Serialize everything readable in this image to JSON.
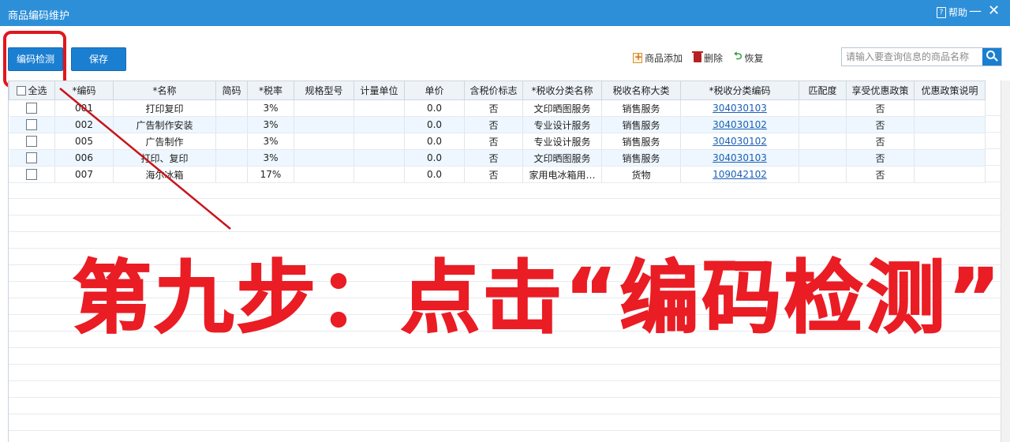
{
  "window": {
    "title": "商品编码维护",
    "help_label": "帮助",
    "minimize": "—",
    "close": "✕"
  },
  "toolbar": {
    "check_label": "编码检测",
    "save_label": "保存",
    "add_label": "商品添加",
    "delete_label": "删除",
    "restore_label": "恢复",
    "restore_icon": "⮌",
    "search_placeholder": "请输入要查询信息的商品名称"
  },
  "table": {
    "select_all": "全选",
    "columns": [
      "*编码",
      "*名称",
      "简码",
      "*税率",
      "规格型号",
      "计量单位",
      "单价",
      "含税价标志",
      "*税收分类名称",
      "税收名称大类",
      "*税收分类编码",
      "匹配度",
      "享受优惠政策",
      "优惠政策说明"
    ],
    "rows": [
      [
        "001",
        "打印复印",
        "",
        "3%",
        "",
        "",
        "0.0",
        "否",
        "文印晒图服务",
        "销售服务",
        "304030103",
        "",
        "否",
        ""
      ],
      [
        "002",
        "广告制作安装",
        "",
        "3%",
        "",
        "",
        "0.0",
        "否",
        "专业设计服务",
        "销售服务",
        "304030102",
        "",
        "否",
        ""
      ],
      [
        "005",
        "广告制作",
        "",
        "3%",
        "",
        "",
        "0.0",
        "否",
        "专业设计服务",
        "销售服务",
        "304030102",
        "",
        "否",
        ""
      ],
      [
        "006",
        "打印、复印",
        "",
        "3%",
        "",
        "",
        "0.0",
        "否",
        "文印晒图服务",
        "销售服务",
        "304030103",
        "",
        "否",
        ""
      ],
      [
        "007",
        "海尔冰箱",
        "",
        "17%",
        "",
        "",
        "0.0",
        "否",
        "家用电冰箱用…",
        "货物",
        "109042102",
        "",
        "否",
        ""
      ]
    ]
  },
  "annotation": {
    "text": "第九步：点击“编码检测”",
    "color": "#ea1c24"
  },
  "colors": {
    "titlebar": "#2d8fd8",
    "button": "#1b7fd1",
    "link": "#1a5fb4"
  }
}
